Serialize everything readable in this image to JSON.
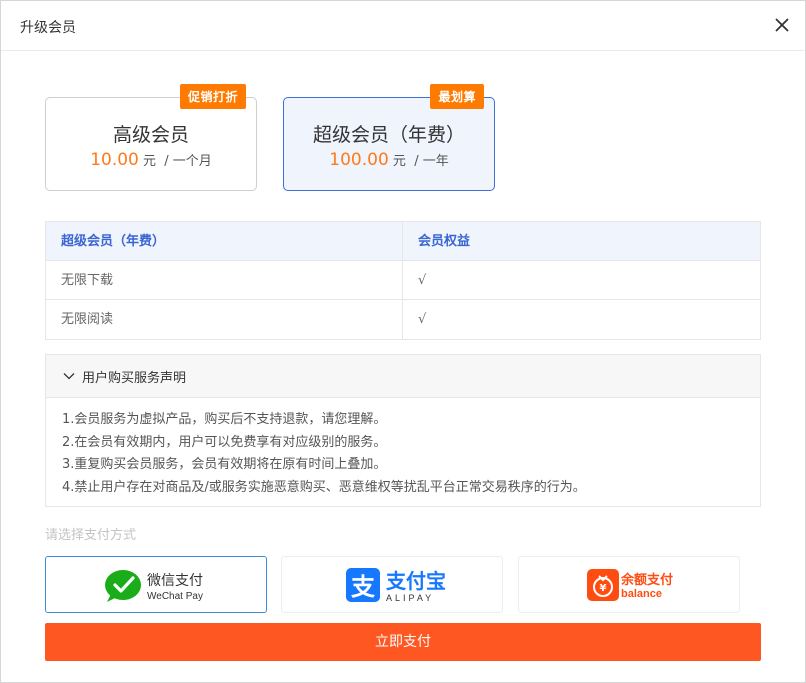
{
  "dialog": {
    "title": "升级会员"
  },
  "plans": [
    {
      "tag": "促销打折",
      "name": "高级会员",
      "price": "10.00",
      "unit": "元",
      "period": "/ 一个月"
    },
    {
      "tag": "最划算",
      "name": "超级会员（年费）",
      "price": "100.00",
      "unit": "元",
      "period": "/ 一年"
    }
  ],
  "benefits": {
    "headers": [
      "超级会员（年费）",
      "会员权益"
    ],
    "rows": [
      [
        "无限下载",
        "√"
      ],
      [
        "无限阅读",
        "√"
      ]
    ]
  },
  "statement": {
    "title": "用户购买服务声明",
    "lines": [
      "1.会员服务为虚拟产品，购买后不支持退款，请您理解。",
      "2.在会员有效期内，用户可以免费享有对应级别的服务。",
      "3.重复购买会员服务，会员有效期将在原有时间上叠加。",
      "4.禁止用户存在对商品及/或服务实施恶意购买、恶意维权等扰乱平台正常交易秩序的行为。"
    ]
  },
  "payment": {
    "label": "请选择支付方式",
    "wechat": {
      "name": "微信支付",
      "sub": "WeChat Pay"
    },
    "alipay": {
      "name": "支付宝",
      "sub": "ALIPAY"
    },
    "balance": {
      "name": "余额支付",
      "sub": "balance"
    },
    "submit": "立即支付"
  },
  "colors": {
    "accent": "#ff5722",
    "price": "#ff7a1a",
    "tag": "#ff7a00",
    "selected": "#3f6fd6",
    "wechat": "#1aad19",
    "alipay": "#1677ff",
    "balance": "#ff4d12"
  }
}
